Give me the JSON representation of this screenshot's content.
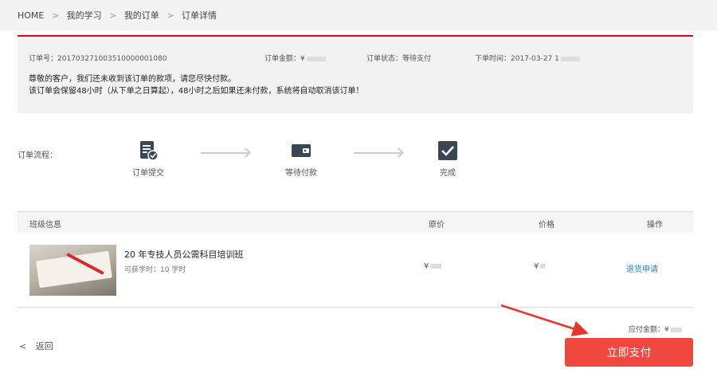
{
  "breadcrumb": {
    "home": "HOME",
    "separator": ">",
    "items": [
      "我的学习",
      "我的订单",
      "订单详情"
    ]
  },
  "order": {
    "number_label": "订单号：",
    "number": "201703271003510000001080",
    "amount_label": "订单金额：",
    "amount": "¥",
    "status_label": "订单状态：",
    "status": "等待支付",
    "time_label": "下单时间：",
    "time": "2017-03-27 1",
    "notice_line1": "尊敬的客户，我们还未收到该订单的款项，请您尽快付款。",
    "notice_line2": "该订单会保留48小时（从下单之日算起），48小时之后如果还未付款，系统将自动取消该订单！"
  },
  "flow": {
    "label": "订单流程：",
    "steps": [
      {
        "label": "订单提交",
        "icon": "document-check-icon"
      },
      {
        "label": "等待付款",
        "icon": "wallet-icon"
      },
      {
        "label": "完成",
        "icon": "checkmark-icon"
      }
    ]
  },
  "table": {
    "headers": {
      "info": "班级信息",
      "original": "原价",
      "price": "价格",
      "action": "操作"
    },
    "rows": [
      {
        "name": "20  年专技人员公需科目培训班",
        "hours": "可获学时：10 学时",
        "original": "¥",
        "price": "¥",
        "action": "退货申请"
      }
    ]
  },
  "payment": {
    "due_label": "应付金额：",
    "due_amount": "¥",
    "pay_button": "立即支付",
    "back": "返回"
  },
  "colors": {
    "accent_red": "#f0483e",
    "link_blue": "#2a7fd4",
    "top_border": "#e60012",
    "icon_dark": "#3b4654"
  }
}
